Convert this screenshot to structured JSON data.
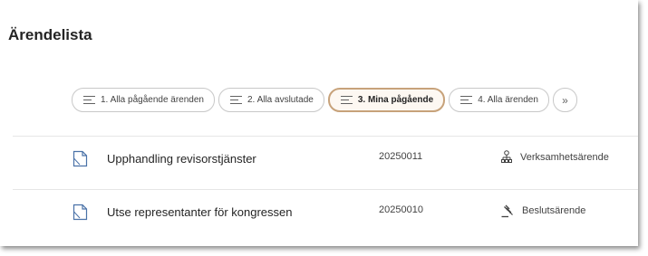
{
  "page": {
    "title": "Ärendelista"
  },
  "filters": [
    {
      "label": "1. Alla pågående ärenden",
      "active": false
    },
    {
      "label": "2. Alla avslutade",
      "active": false
    },
    {
      "label": "3. Mina pågående",
      "active": true
    },
    {
      "label": "4. Alla ärenden",
      "active": false
    }
  ],
  "more_label": "»",
  "rows": [
    {
      "title": "Upphandling revisorstjänster",
      "number": "20250011",
      "type": "Verksamhetsärende",
      "type_icon": "org-chart-icon"
    },
    {
      "title": "Utse representanter för kongressen",
      "number": "20250010",
      "type": "Beslutsärende",
      "type_icon": "gavel-icon"
    }
  ],
  "colors": {
    "active_border": "#c7a27a",
    "active_bg": "#fdf8f2",
    "doc_icon": "#4a72a8"
  }
}
